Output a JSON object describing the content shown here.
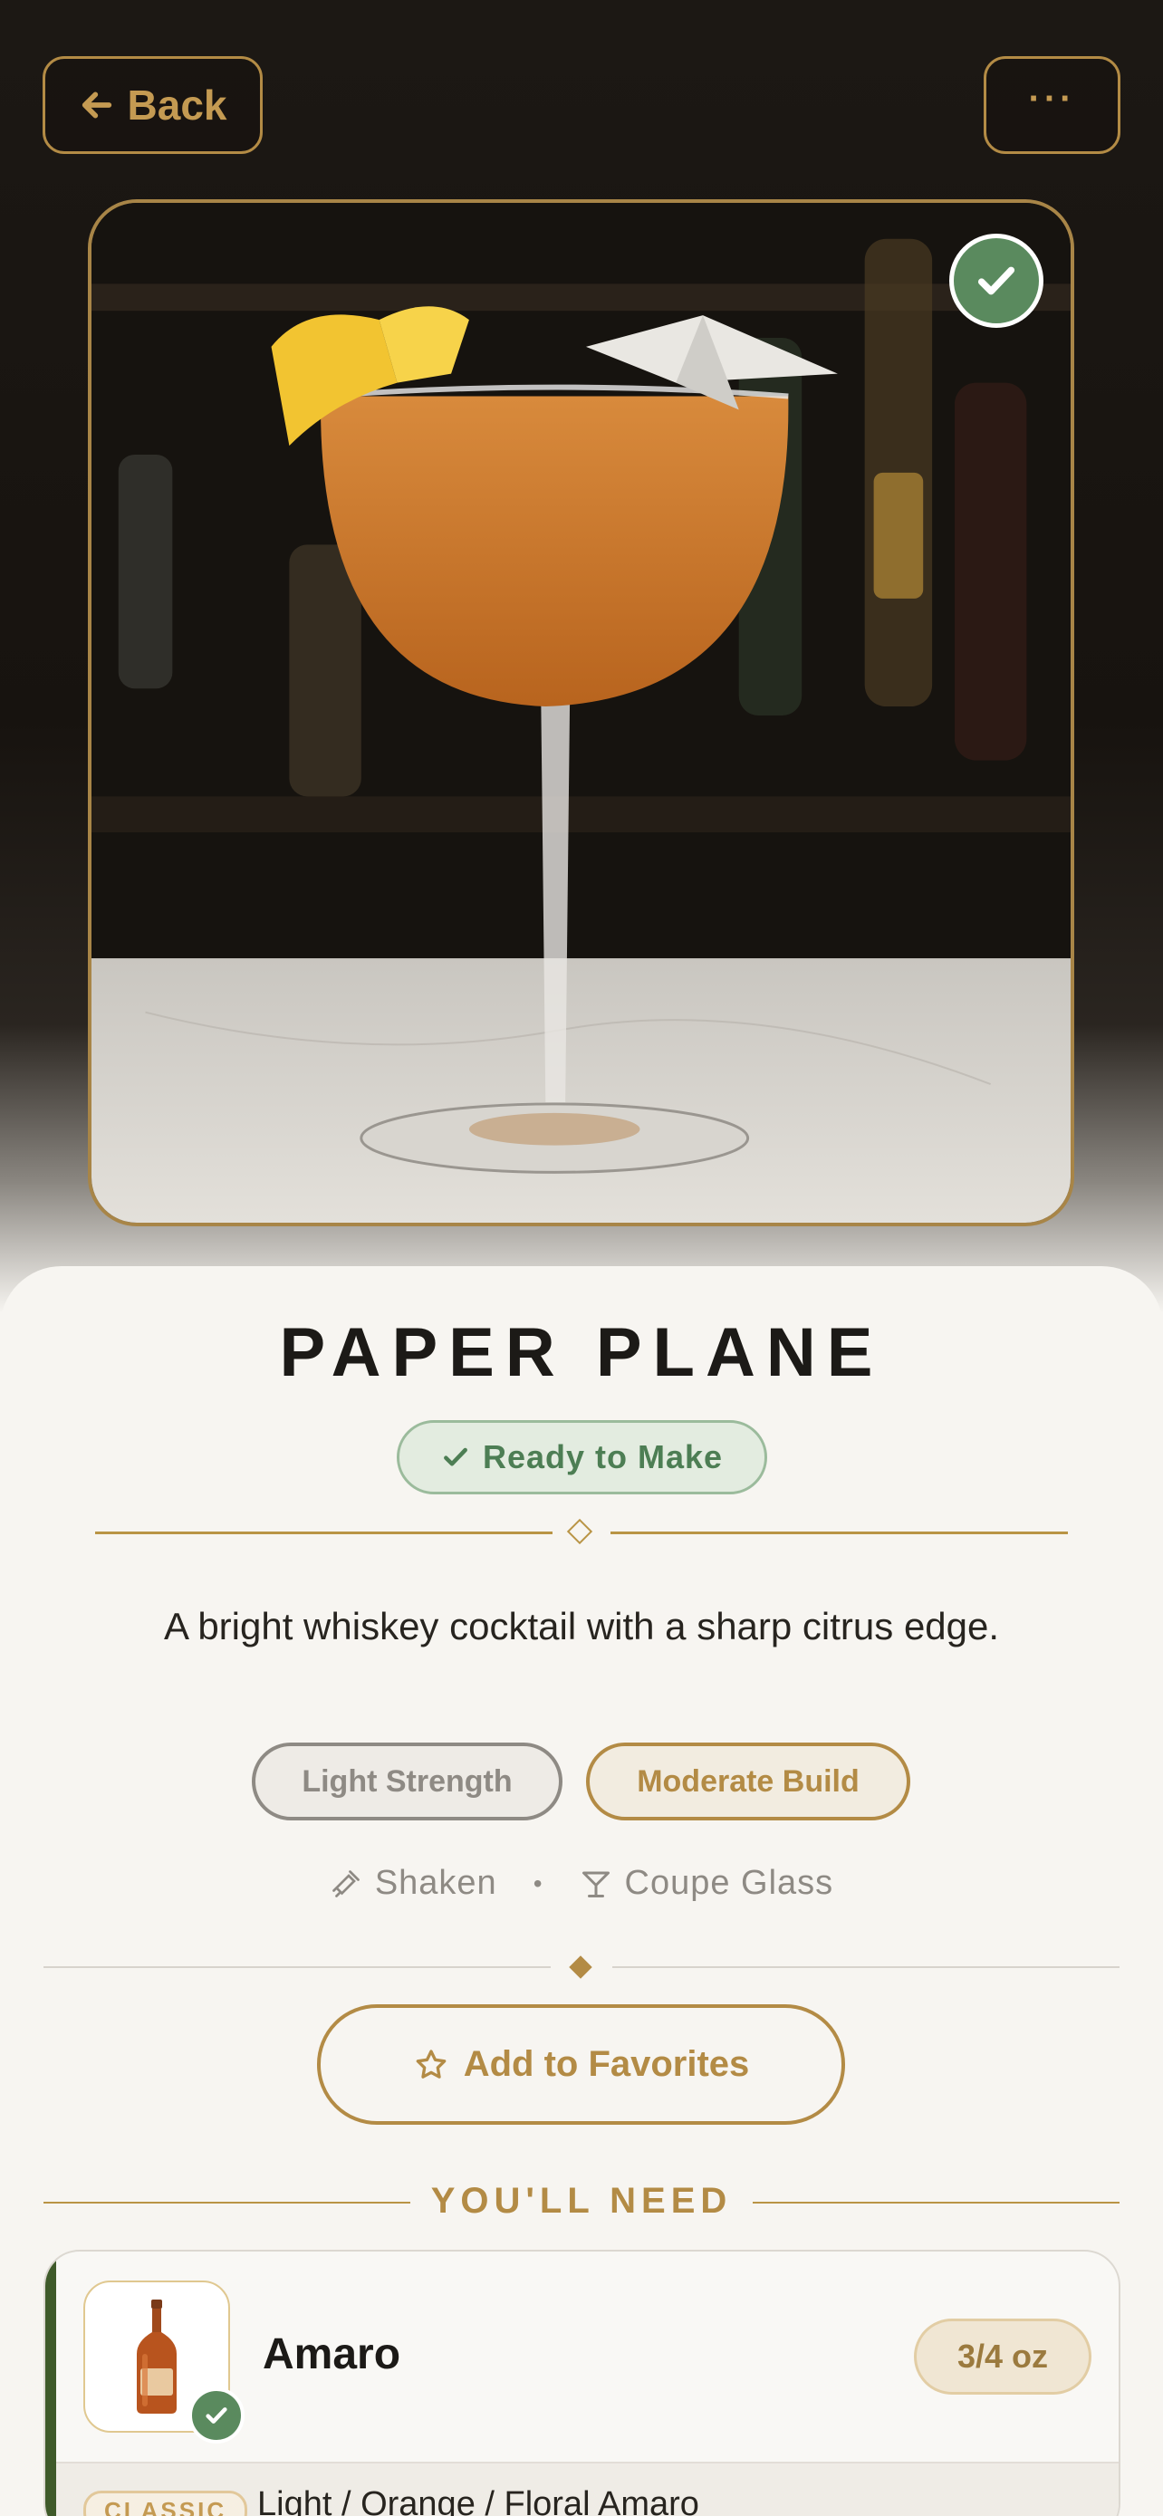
{
  "nav": {
    "back_label": "Back",
    "more_label": "···"
  },
  "cocktail": {
    "name": "PAPER PLANE",
    "status": "Ready to Make",
    "description": "A bright whiskey cocktail with a sharp citrus edge.",
    "strength": "Light Strength",
    "build": "Moderate Build",
    "method": "Shaken",
    "separator": "•",
    "glass": "Coupe Glass"
  },
  "actions": {
    "favorite_label": "Add to Favorites"
  },
  "ingredients": {
    "heading": "YOU'LL NEED",
    "items": [
      {
        "name": "Amaro",
        "quantity": "3/4 oz",
        "tag": "CLASSIC",
        "description": "Light / Orange / Floral Amaro"
      }
    ]
  },
  "colors": {
    "accent": "#b38b45",
    "success": "#5a8a5e",
    "background": "#f7f5f1",
    "card_accent": "#3f5a2a"
  },
  "icons": {
    "back": "arrow-left-icon",
    "more": "ellipsis-icon",
    "ready": "check-circle-icon",
    "method": "shaker-icon",
    "glass": "cocktail-glass-icon",
    "favorite": "star-outline-icon",
    "ingredient": "bottle-icon",
    "owned": "check-icon"
  }
}
